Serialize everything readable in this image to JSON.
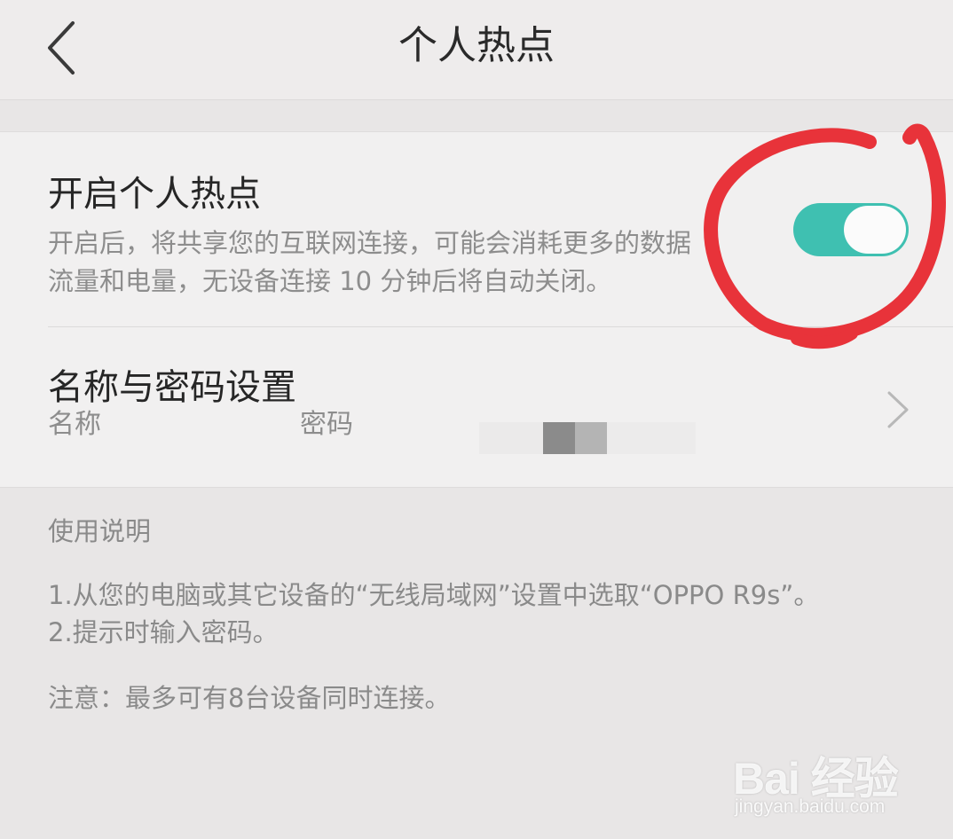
{
  "header": {
    "title": "个人热点",
    "back_icon": "chevron-left-icon"
  },
  "hotspot": {
    "title": "开启个人热点",
    "description_line1": "开启后，将共享您的互联网连接，可能会消耗更多的数据",
    "description_line2": "流量和电量，无设备连接 10 分钟后将自动关闭。",
    "toggle_state": "on",
    "toggle_color": "#3fc0b1"
  },
  "name_password": {
    "title": "名称与密码设置",
    "name_label": "名称",
    "password_label": "密码",
    "chevron_icon": "chevron-right-icon"
  },
  "help": {
    "heading": "使用说明",
    "step1": "1.从您的电脑或其它设备的“无线局域网”设置中选取“OPPO R9s”。",
    "step2": "2.提示时输入密码。",
    "note": "注意：最多可有8台设备同时连接。"
  },
  "annotation": {
    "color": "#e8333a"
  },
  "watermark": {
    "logo": "Bai 经验",
    "url": "jingyan.baidu.com"
  }
}
